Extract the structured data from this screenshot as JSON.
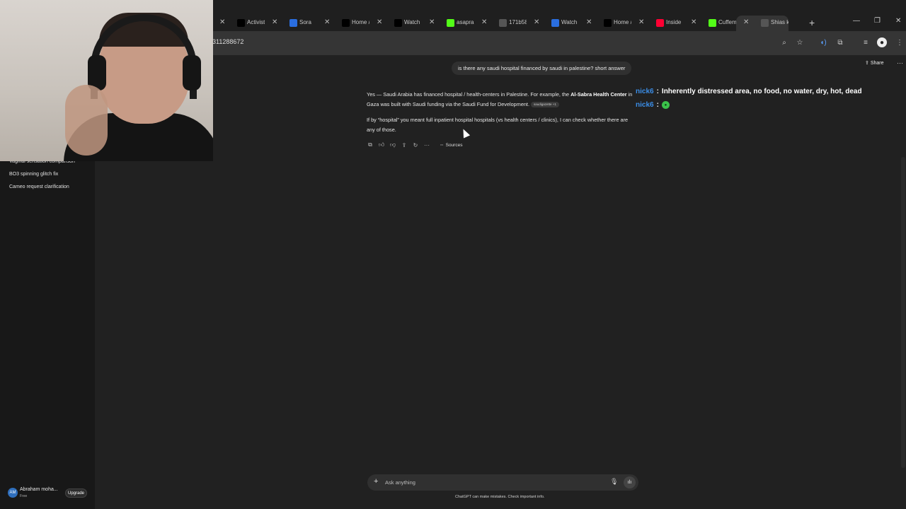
{
  "browser": {
    "tabs": [
      {
        "label": "Activist",
        "fav": "tiktok-icon",
        "fav_color": "#000000"
      },
      {
        "label": "Sora",
        "fav": "sora-icon",
        "fav_color": "#2a6ee0"
      },
      {
        "label": "Home /",
        "fav": "x-icon",
        "fav_color": "#000000"
      },
      {
        "label": "Watch",
        "fav": "tiktok-icon",
        "fav_color": "#000000"
      },
      {
        "label": "asapran",
        "fav": "kick-icon",
        "fav_color": "#53fc18"
      },
      {
        "label": "171b58",
        "fav": "globe-icon",
        "fav_color": "#555555"
      },
      {
        "label": "Watch",
        "fav": "sora-icon",
        "fav_color": "#2a6ee0"
      },
      {
        "label": "Home /",
        "fav": "x-icon",
        "fav_color": "#000000"
      },
      {
        "label": "Inside",
        "fav": "youtube-icon",
        "fav_color": "#ff0033"
      },
      {
        "label": "Cuffem",
        "fav": "kick-icon",
        "fav_color": "#53fc18"
      },
      {
        "label": "Shias k",
        "fav": "chatgpt-icon",
        "fav_color": "#555555",
        "active": true
      }
    ],
    "url": "311288672"
  },
  "sidebar": {
    "items": [
      "Vaginal sensation comparison",
      "BO3 spinning glitch fix",
      "Cameo request clarification"
    ],
    "user_initials": "AM",
    "user_name": "Abraham moha...",
    "user_plan": "Free",
    "upgrade_label": "Upgrade"
  },
  "header": {
    "share_label": "Share"
  },
  "conversation": {
    "user_message": "is there any saudi hospital financed by saudi in palestine? short answer",
    "answer_p1_a": "Yes — Saudi Arabia has financed hospital / health-centers in Palestine. For example, the ",
    "answer_p1_bold1": "Al-Sabra Health Center",
    "answer_p1_b": " in Gaza was built with Saudi funding via the Saudi Fund for Development.",
    "citation": "saudigazette +1",
    "answer_p2": "If by “hospital” you meant full inpatient hospital hospitals (vs health centers / clinics), I can check whether there are any of those.",
    "sources_label": "Sources"
  },
  "chat_overlay": [
    {
      "user": "nick6",
      "message": "Inherently distressed area, no food, no water, dry, hot, dead"
    },
    {
      "user": "nick6",
      "message": ""
    }
  ],
  "composer": {
    "placeholder": "Ask anything",
    "disclaimer": "ChatGPT can make mistakes. Check important info."
  },
  "colors": {
    "overlay_user": "#3b8ee8",
    "background": "#212121",
    "sidebar": "#181818"
  }
}
